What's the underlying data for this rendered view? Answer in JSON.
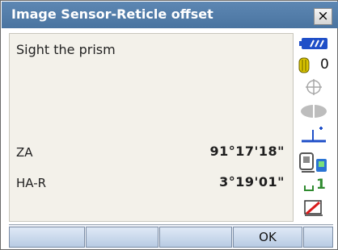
{
  "window": {
    "title": "Image Sensor-Reticle offset",
    "close_label": "×"
  },
  "content": {
    "message": "Sight the prism",
    "rows": [
      {
        "label": "ZA",
        "value": "91°17'18\""
      },
      {
        "label": "HA-R",
        "value": "3°19'01\""
      }
    ]
  },
  "status": {
    "prism_constant": "0",
    "laser_pointer_level": "1",
    "battery_icon": "battery-icon",
    "target_icon": "prism-target-icon",
    "compensator_icon": "crosshair-icon",
    "signal_icon": "signal-level-icon",
    "tilt_icon": "tilt-icon",
    "interface_icon": "device-interface-icon",
    "input_icon": "input-mode-icon",
    "pen_icon": "pen-icon"
  },
  "softkeys": [
    "",
    "",
    "",
    "OK",
    ""
  ],
  "colors": {
    "titlebar": "#5479a6",
    "content_bg": "#f3f1ea",
    "softkey_bg": "#c8d8ec",
    "status_blue": "#1f4fc8",
    "status_green": "#2f8a2f"
  }
}
